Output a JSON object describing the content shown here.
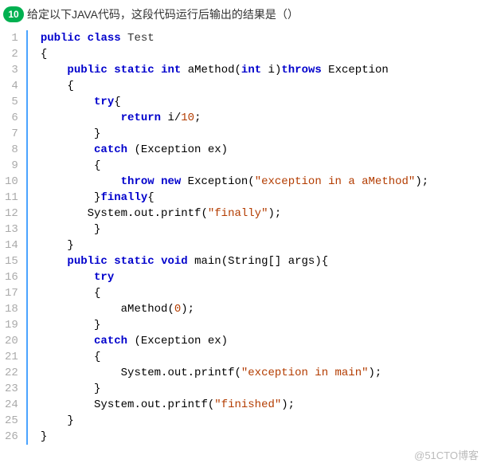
{
  "question": {
    "number": "10",
    "text": "给定以下JAVA代码，这段代码运行后输出的结果是（）"
  },
  "code": {
    "indent": {
      "L1": "    ",
      "L2": "        ",
      "L3": "            ",
      "L4": "                "
    },
    "kw": {
      "public": "public",
      "class": "class",
      "static": "static",
      "int": "int",
      "throws": "throws",
      "try": "try",
      "return": "return",
      "catch": "catch",
      "throw": "throw",
      "new": "new",
      "finally": "finally",
      "void": "void"
    },
    "id": {
      "Test": " Test",
      "aMethod": " aMethod(",
      "i_param_space": " i)",
      "Exception": " Exception",
      "ivar": " i/",
      "ex_param": " (Exception ex)",
      "throw_sp": " ",
      "Exception_ctor": " Exception(",
      "aMethod_call": "aMethod(",
      "sysout": "System.out.printf(",
      "sysout_sp": "   System.out.printf(",
      "main": " main(String[] args){"
    },
    "num": {
      "ten": "10",
      "zero": "0"
    },
    "str": {
      "excA": "\"exception in a aMethod\"",
      "finally": "\"finally\"",
      "excMain": "\"exception in main\"",
      "finished": "\"finished\""
    },
    "sym": {
      "obrace": "{",
      "cbrace": "}",
      "cbrace_finally": "}",
      "cparen_semi": ");",
      "cparen_brace": "){",
      "semi": ";"
    }
  },
  "watermark": "@51CTO博客"
}
